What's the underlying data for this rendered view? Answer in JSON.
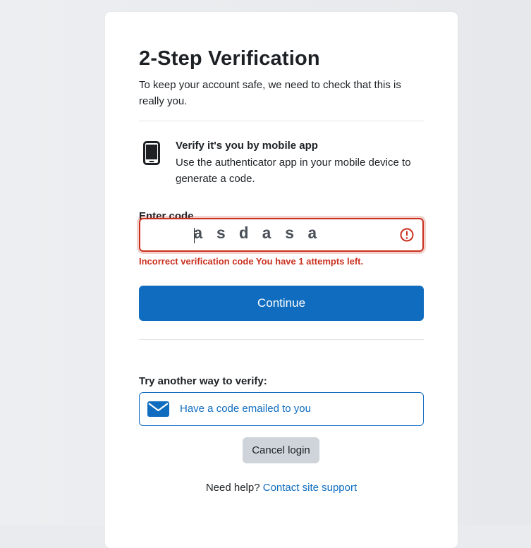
{
  "header": {
    "title": "2-Step Verification",
    "subtitle": "To keep your account safe, we need to check that this is really you."
  },
  "method": {
    "icon": "mobile-phone-icon",
    "heading": "Verify it's you by mobile app",
    "description": "Use the authenticator app in your mobile device to generate a code."
  },
  "code": {
    "label": "Enter code",
    "value": "asdasa",
    "error_icon": "exclamation-circle-icon",
    "error_message": "Incorrect verification code You have 1 attempts left."
  },
  "actions": {
    "continue_label": "Continue",
    "alt_label": "Try another way to verify:",
    "alt_option_icon": "envelope-icon",
    "alt_option_label": "Have a code emailed to you",
    "cancel_label": "Cancel login"
  },
  "footer": {
    "help_text": "Need help?",
    "help_link": "Contact site support"
  },
  "colors": {
    "primary": "#0f6cbf",
    "error": "#ca3120",
    "secondary_button": "#ced4da",
    "background": "#e9ebee"
  }
}
